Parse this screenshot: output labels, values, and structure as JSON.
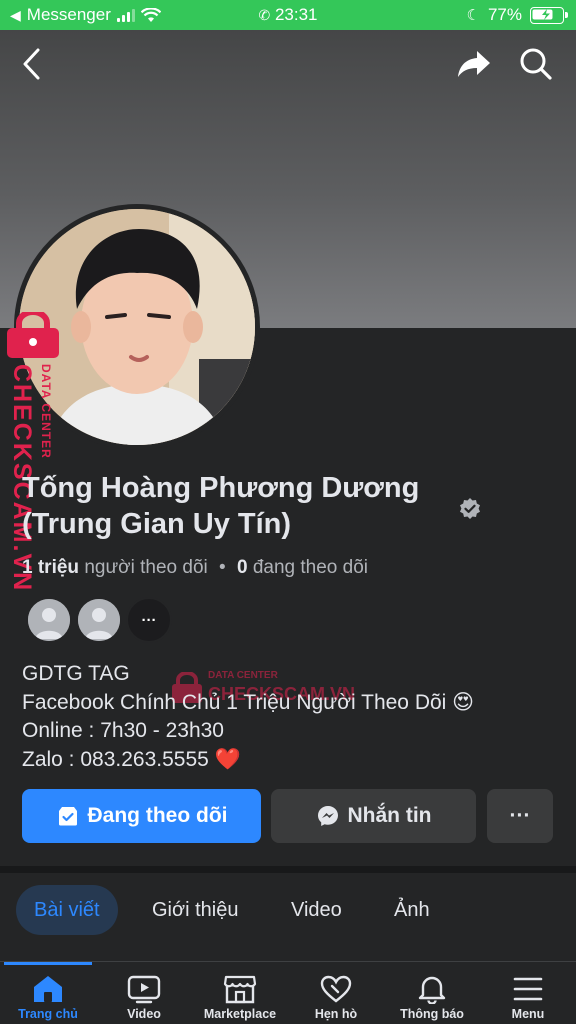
{
  "status_bar": {
    "back_app": "Messenger",
    "time": "23:31",
    "battery": "77%"
  },
  "header": {
    "back_icon": "chevron-left-icon",
    "share_icon": "share-arrow-icon",
    "search_icon": "search-icon"
  },
  "profile": {
    "name": "Tống Hoàng Phương Dương (Trung Gian Uy Tín)",
    "followers_count": "1 triệu",
    "followers_label": "người theo dõi",
    "separator": "•",
    "following_count": "0",
    "following_label": "đang theo dõi",
    "more_avatars": "···",
    "bio": [
      "GDTG TAG",
      "Facebook Chính Chủ 1 Triệu Người Theo Dõi 😍",
      "Online : 7h30 - 23h30",
      "Zalo : 083.263.5555 ❤️"
    ]
  },
  "watermark": {
    "text": "CHECKSCAM.VN",
    "subtext": "DATA CENTER"
  },
  "actions": {
    "follow": "Đang theo dõi",
    "message": "Nhắn tin",
    "more": "···"
  },
  "tabs": [
    "Bài viết",
    "Giới thiệu",
    "Video",
    "Ảnh"
  ],
  "bottom_nav": [
    "Trang chủ",
    "Video",
    "Marketplace",
    "Hẹn hò",
    "Thông báo",
    "Menu"
  ],
  "colors": {
    "accent": "#2d88ff",
    "status_bar": "#34c759",
    "background": "#242526",
    "watermark": "#e0224d"
  }
}
